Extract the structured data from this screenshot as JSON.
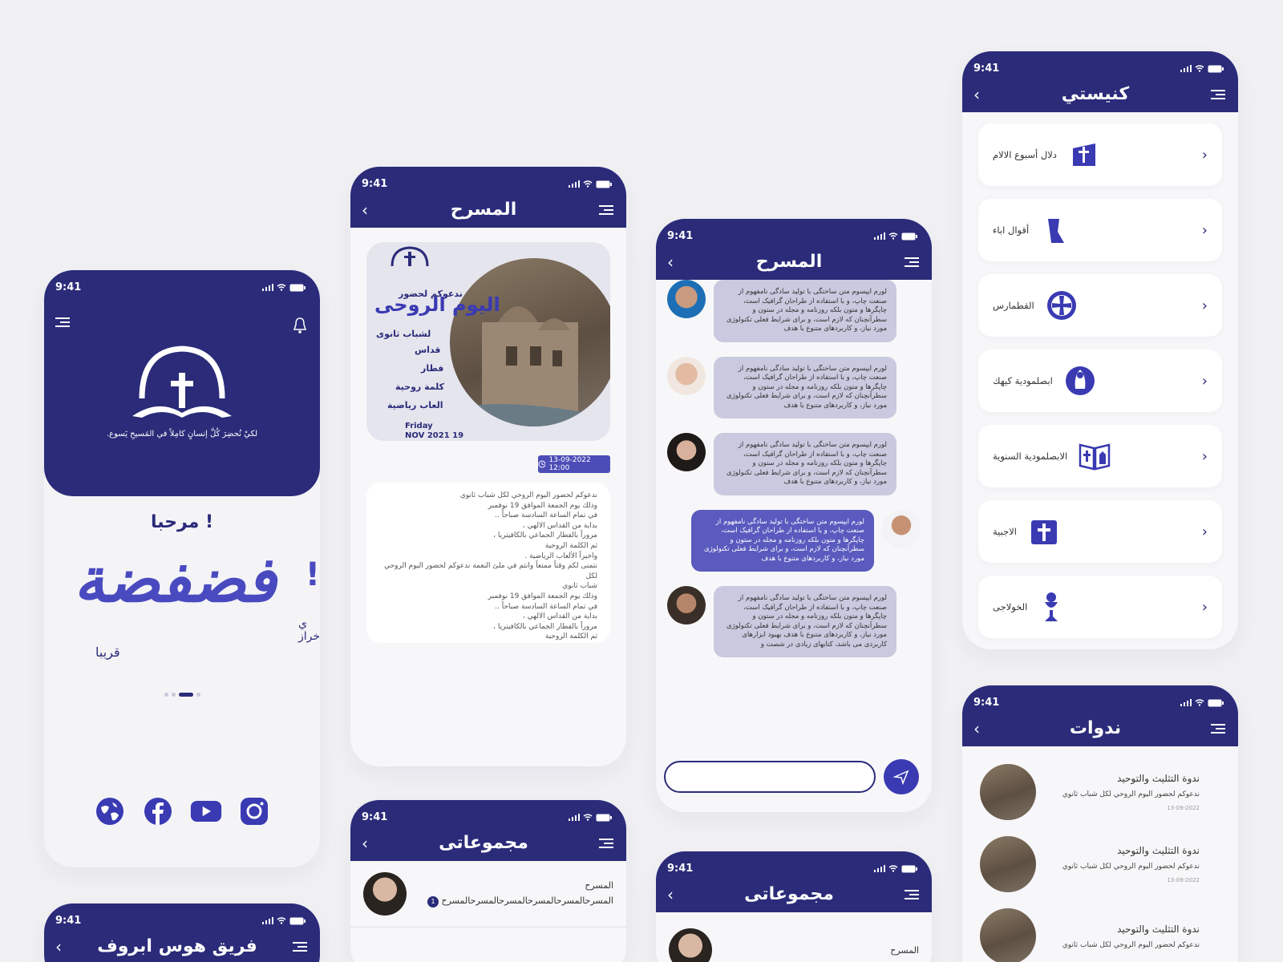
{
  "colors": {
    "primary": "#2b2b7a",
    "accent": "#4a4ac0",
    "bubble": "#c9c9df",
    "bubble_own": "#5a5abf"
  },
  "status_time": "9:41",
  "home": {
    "tagline": "لكيْ نُحضِرَ كُلَّ إنسانٍ كامِلاً في المَسيحِ يَسوع.",
    "welcome": "مرحبا !",
    "calligraphy": "فضفضة",
    "calligraphy_sub": "قريبا",
    "peek_line1": "!",
    "peek_line2": "ي",
    "peek_line3": "خراز",
    "icons": [
      "globe-icon",
      "facebook-icon",
      "youtube-icon",
      "instagram-icon"
    ]
  },
  "theater": {
    "title": "المسرح",
    "poster_invite": "ندعوكم لحضور",
    "poster_title": "اليوم الروحى",
    "poster_for": "لشباب ثانوى",
    "poster_items": [
      "قداس",
      "فطار",
      "كلمة روحية",
      "العاب رياضية"
    ],
    "poster_day": "Friday",
    "poster_date": "19 NOV 2021",
    "date_chip": "13-09-2022 12:00",
    "description": [
      "ندعوكم لحضور اليوم الروحي لكل شباب ثانوي",
      "وذلك يوم الجمعة الموافق 19 نوفمبر",
      "في تمام الساعة السادسة صباحاً ..",
      "بداية من القداس الالهي ،",
      "مروراً بالفطار الجماعي بالكافيتريا ،",
      "ثم الكلمة الروحية",
      "واخيراً الألعاب الرياضية .",
      "نتمنى لكم وقتاً ممتعاً وانتم في ملئ النعمة ندعوكم لحضور اليوم الروحي لكل",
      "شباب ثانوي",
      "وذلك يوم الجمعة الموافق 19 نوفمبر",
      "في تمام الساعة السادسة صباحاً ..",
      "بداية من القداس الالهي ،",
      "مروراً بالفطار الجماعي بالكافيتريا ،",
      "ثم الكلمة الروحية"
    ]
  },
  "groups": {
    "title": "مجموعاتى",
    "items": [
      {
        "name": "المسرح",
        "message": "المسرحالمسرحالمسرحالمسرحالمسرحالمسرح",
        "unread": "1"
      }
    ],
    "peek_name": "المسرح"
  },
  "chat": {
    "title": "المسرح",
    "messages": [
      {
        "side": "left",
        "text": "لورم ایپسوم متن ساختگی با تولید سادگی نامفهوم از صنعت چاپ، و با استفاده از طراحان گرافیک است، چاپگرها و متون بلکه روزنامه و مجله در ستون و سطرآنچنان که لازم است، و برای شرایط فعلی تکنولوژی مورد نیاز، و کاربردهای متنوع با هدف"
      },
      {
        "side": "left",
        "text": "لورم ایپسوم متن ساختگی با تولید سادگی نامفهوم از صنعت چاپ، و با استفاده از طراحان گرافیک است، چاپگرها و متون بلکه روزنامه و مجله در ستون و سطرآنچنان که لازم است، و برای شرایط فعلی تکنولوژی مورد نیاز، و کاربردهای متنوع با هدف"
      },
      {
        "side": "left",
        "text": "لورم ایپسوم متن ساختگی با تولید سادگی نامفهوم از صنعت چاپ، و با استفاده از طراحان گرافیک است، چاپگرها و متون بلکه روزنامه و مجله در ستون و سطرآنچنان که لازم است، و برای شرایط فعلی تکنولوژی مورد نیاز، و کاربردهای متنوع با هدف"
      },
      {
        "side": "right",
        "text": "لورم ایپسوم متن ساختگی با تولید سادگی نامفهوم از صنعت چاپ، و با استفاده از طراحان گرافیک است، چاپگرها و متون بلکه روزنامه و مجله در ستون و سطرآنچنان که لازم است، و برای شرایط فعلی تکنولوژی مورد نیاز، و کاربردهای متنوع با هدف"
      },
      {
        "side": "left",
        "text": "لورم ایپسوم متن ساختگی با تولید سادگی نامفهوم از صنعت چاپ، و با استفاده از طراحان گرافیک است، چاپگرها و متون بلکه روزنامه و مجله در ستون و سطرآنچنان که لازم است، و برای شرایط فعلی تکنولوژی مورد نیاز، و کاربردهای متنوع با هدف بهبود ابزارهای کاربردی می باشد، کتابهای زیادی در شصت و"
      }
    ]
  },
  "church": {
    "title": "كنيستي",
    "items": [
      {
        "label": "دلال أسبوع الالام",
        "icon": "cross-church-icon"
      },
      {
        "label": "أقوال اباء",
        "icon": "saint-icon"
      },
      {
        "label": "القطمارس",
        "icon": "coptic-cross-icon"
      },
      {
        "label": "ابصلمودية كيهك",
        "icon": "virgin-icon"
      },
      {
        "label": "الابصلمودية السنوية",
        "icon": "open-book-icon"
      },
      {
        "label": "الاجبية",
        "icon": "book-cross-icon"
      },
      {
        "label": "الخولاجى",
        "icon": "chalice-icon"
      }
    ]
  },
  "seminars": {
    "title": "ندوات",
    "items": [
      {
        "title": "ندوة التثليث والتوحيد",
        "desc": "ندعوكم لحضور اليوم الروحي لكل شباب ثانوي",
        "date": "13-09-2022"
      },
      {
        "title": "ندوة التثليث والتوحيد",
        "desc": "ندعوكم لحضور اليوم الروحي لكل شباب ثانوي",
        "date": "13-09-2022"
      },
      {
        "title": "ندوة التثليث والتوحيد",
        "desc": "ندعوكم لحضور اليوم الروحي لكل شباب ثانوي",
        "date": ""
      }
    ]
  },
  "team": {
    "title": "فريق هوس ابروف"
  }
}
